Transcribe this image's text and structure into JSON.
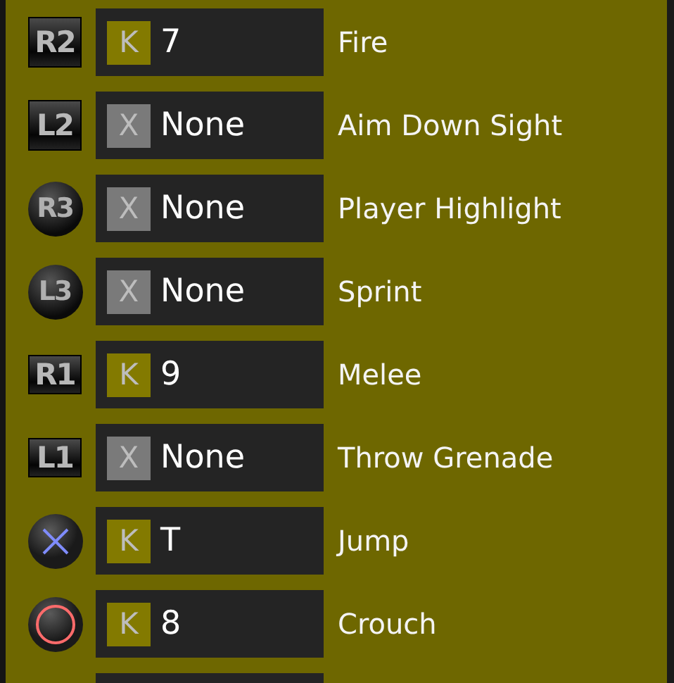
{
  "bindings": [
    {
      "button": {
        "kind": "trigger",
        "label": "R2"
      },
      "key": {
        "kind": "keyboard",
        "badge": "K",
        "value": "7"
      },
      "action": "Fire"
    },
    {
      "button": {
        "kind": "trigger",
        "label": "L2"
      },
      "key": {
        "kind": "none",
        "badge": "X",
        "value": "None"
      },
      "action": "Aim Down Sight"
    },
    {
      "button": {
        "kind": "stick",
        "label": "R3"
      },
      "key": {
        "kind": "none",
        "badge": "X",
        "value": "None"
      },
      "action": "Player Highlight"
    },
    {
      "button": {
        "kind": "stick",
        "label": "L3"
      },
      "key": {
        "kind": "none",
        "badge": "X",
        "value": "None"
      },
      "action": "Sprint"
    },
    {
      "button": {
        "kind": "trigger",
        "label": "R1"
      },
      "key": {
        "kind": "keyboard",
        "badge": "K",
        "value": "9"
      },
      "action": "Melee"
    },
    {
      "button": {
        "kind": "trigger",
        "label": "L1"
      },
      "key": {
        "kind": "none",
        "badge": "X",
        "value": "None"
      },
      "action": "Throw Grenade"
    },
    {
      "button": {
        "kind": "cross"
      },
      "key": {
        "kind": "keyboard",
        "badge": "K",
        "value": "T"
      },
      "action": "Jump"
    },
    {
      "button": {
        "kind": "circle"
      },
      "key": {
        "kind": "keyboard",
        "badge": "K",
        "value": "8"
      },
      "action": "Crouch"
    }
  ]
}
